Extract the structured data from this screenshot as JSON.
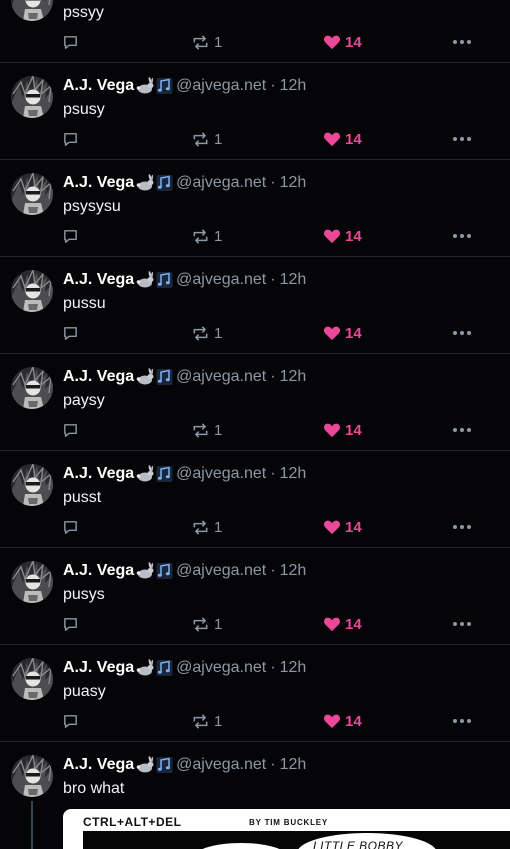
{
  "colors": {
    "background": "#050507",
    "divider": "#21262f",
    "muted": "#8b98a5",
    "like": "#ec4899",
    "icon": "#8b98a5"
  },
  "icons": {
    "reply": "speech-bubble-icon",
    "repost": "repost-arrows-icon",
    "like": "heart-icon",
    "more": "ellipsis-icon",
    "emoji": [
      "rabbit-emoji",
      "musical-notes-emoji"
    ]
  },
  "partial_post": {
    "text": "pssyy",
    "repost_count": "1",
    "like_count": "14"
  },
  "author": {
    "name": "A.J. Vega",
    "handle": "@ajvega.net",
    "separator": "·"
  },
  "posts": [
    {
      "time": "12h",
      "text": "psusy",
      "repost_count": "1",
      "like_count": "14"
    },
    {
      "time": "12h",
      "text": "psysysu",
      "repost_count": "1",
      "like_count": "14"
    },
    {
      "time": "12h",
      "text": "pussu",
      "repost_count": "1",
      "like_count": "14"
    },
    {
      "time": "12h",
      "text": "paysy",
      "repost_count": "1",
      "like_count": "14"
    },
    {
      "time": "12h",
      "text": "pusst",
      "repost_count": "1",
      "like_count": "14"
    },
    {
      "time": "12h",
      "text": "pusys",
      "repost_count": "1",
      "like_count": "14"
    },
    {
      "time": "12h",
      "text": "puasy",
      "repost_count": "1",
      "like_count": "14"
    }
  ],
  "last_post": {
    "time": "12h",
    "text": "bro what",
    "comic": {
      "title": "CTRL+ALT+DEL",
      "credit": "BY TIM BUCKLEY",
      "bubble_text": "LITTLE BOBBY"
    }
  }
}
